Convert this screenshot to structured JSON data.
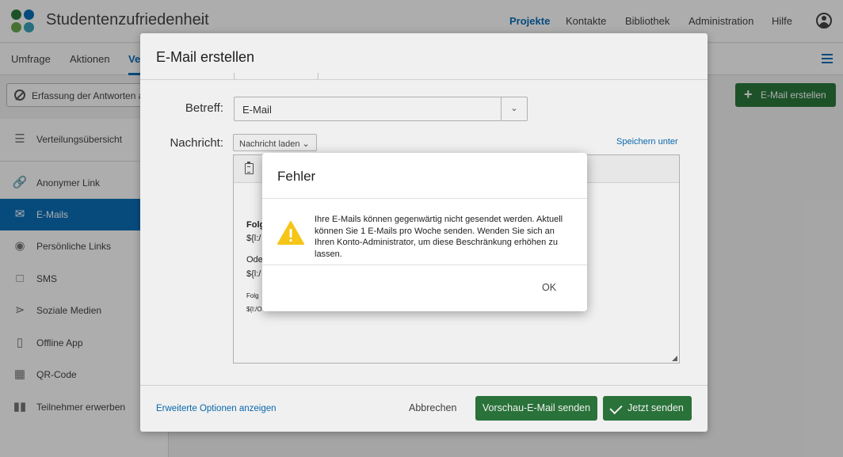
{
  "header": {
    "project_title": "Studentenzufriedenheit",
    "nav": [
      "Projekte",
      "Kontakte",
      "Bibliothek",
      "Administration",
      "Hilfe"
    ],
    "active_nav": "Projekte",
    "logo_colors": [
      "#2c7a3d",
      "#0b6fb8",
      "#6aa84f",
      "#3ba2b8"
    ]
  },
  "subnav": {
    "tabs": [
      "Umfrage",
      "Aktionen",
      "Ve"
    ],
    "active_tab": "Ve"
  },
  "toolbar": {
    "filter_label": "Erfassung der Antworten a",
    "create_email_label": "E-Mail erstellen"
  },
  "sidebar": {
    "items": [
      {
        "label": "Verteilungsübersicht",
        "icon": "overview-icon"
      },
      {
        "label": "Anonymer Link",
        "icon": "link-icon"
      },
      {
        "label": "E-Mails",
        "icon": "envelope-icon"
      },
      {
        "label": "Persönliche Links",
        "icon": "fingerprint-icon"
      },
      {
        "label": "SMS",
        "icon": "chat-bubble-icon"
      },
      {
        "label": "Soziale Medien",
        "icon": "share-icon"
      },
      {
        "label": "Offline App",
        "icon": "tablet-icon"
      },
      {
        "label": "QR-Code",
        "icon": "qr-code-icon"
      },
      {
        "label": "Teilnehmer erwerben",
        "icon": "panel-icon"
      }
    ],
    "active_item": "E-Mails"
  },
  "email_modal": {
    "title": "E-Mail erstellen",
    "subject_label": "Betreff:",
    "subject_value": "E-Mail",
    "message_label": "Nachricht:",
    "load_message_label": "Nachricht laden",
    "save_as_label": "Speichern unter",
    "editor_lines": [
      {
        "text": "Folg",
        "style": "b"
      },
      {
        "text": "${l:/",
        "style": ""
      },
      {
        "text": "Ode",
        "style": ""
      },
      {
        "text": "${l:/",
        "style": ""
      },
      {
        "text": "Folg",
        "style": "sm"
      },
      {
        "text": "${l:/O",
        "style": "sm"
      }
    ],
    "advanced_options_label": "Erweiterte Optionen anzeigen",
    "cancel_label": "Abbrechen",
    "preview_label": "Vorschau-E-Mail senden",
    "send_now_label": "Jetzt senden"
  },
  "error_dialog": {
    "title": "Fehler",
    "message": "Ihre E-Mails können gegenwärtig nicht gesendet werden. Aktuell können Sie 1 E-Mails pro Woche senden. Wenden Sie sich an Ihren Konto-Administrator, um diese Beschränkung erhöhen zu lassen.",
    "ok_label": "OK",
    "icon": "warning-icon"
  },
  "colors": {
    "accent_blue": "#0b6fb8",
    "primary_green": "#2c7a3d",
    "warning_yellow": "#f5c518"
  }
}
